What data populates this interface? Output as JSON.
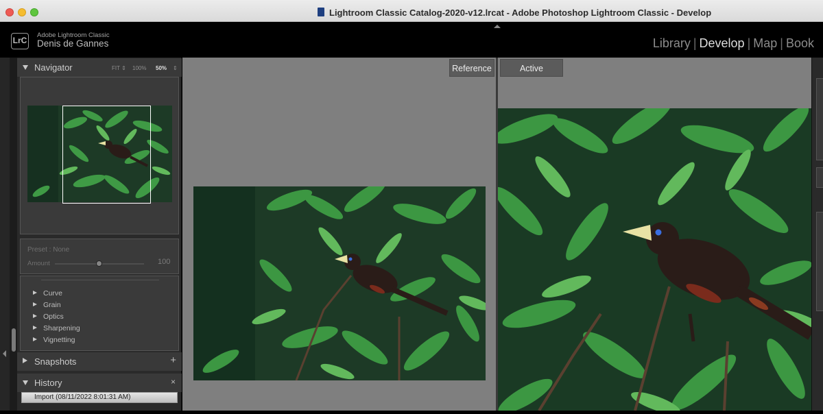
{
  "window": {
    "title": "Lightroom Classic Catalog-2020-v12.lrcat - Adobe Photoshop Lightroom Classic - Develop"
  },
  "identity": {
    "logo": "LrC",
    "app_name": "Adobe Lightroom Classic",
    "user_name": "Denis de Gannes"
  },
  "modules": [
    {
      "label": "Library",
      "active": false
    },
    {
      "label": "Develop",
      "active": true
    },
    {
      "label": "Map",
      "active": false
    },
    {
      "label": "Book",
      "active": false
    }
  ],
  "navigator": {
    "title": "Navigator",
    "zoom_fit": "FIT ⇕",
    "zoom_100": "100%",
    "zoom_50": "50%",
    "zoom_arrows": "⇕"
  },
  "presets": {
    "preset_label": "Preset : None",
    "amount_label": "Amount",
    "amount_value": "100",
    "items": [
      "Curve",
      "Grain",
      "Optics",
      "Sharpening",
      "Vignetting"
    ]
  },
  "snapshots": {
    "title": "Snapshots",
    "add_icon": "+"
  },
  "history": {
    "title": "History",
    "clear_icon": "×",
    "items": [
      "Import (08/11/2022 8:01:31 AM)"
    ]
  },
  "compare": {
    "reference_label": "Reference",
    "active_label": "Active"
  },
  "colors": {
    "photo_background": "#1d3a26",
    "leaf": "#3f9a45",
    "bird_body": "#2a1c18",
    "bird_beak": "#e8e2a4"
  }
}
